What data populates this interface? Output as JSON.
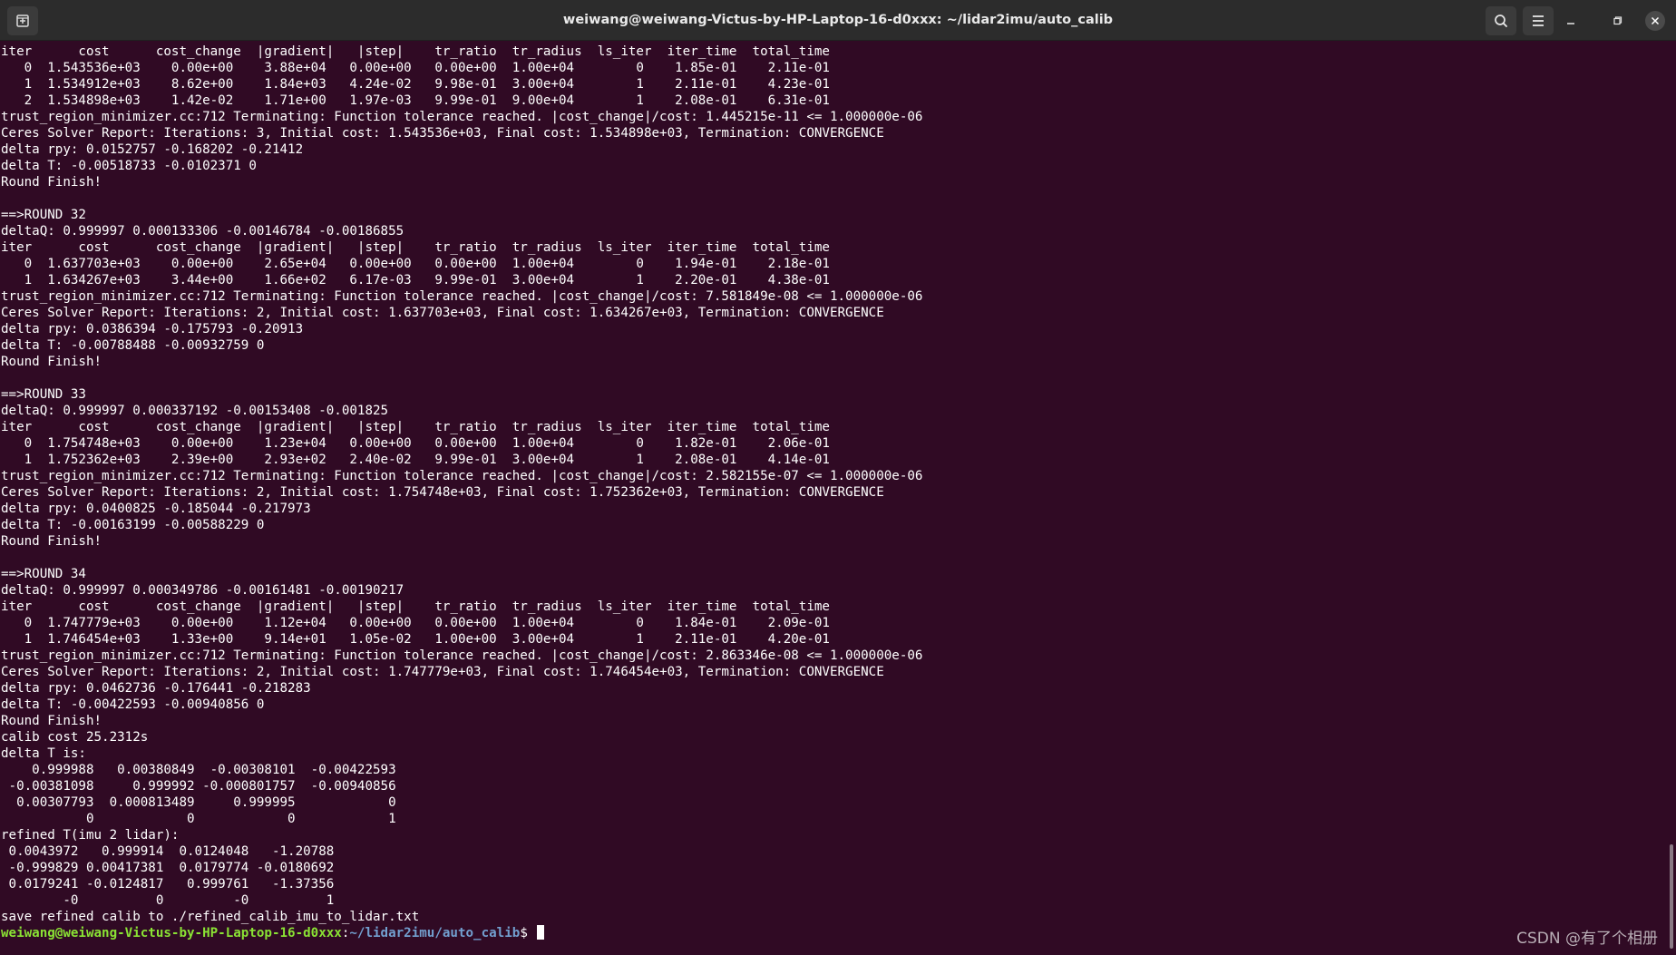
{
  "window": {
    "title": "weiwang@weiwang-Victus-by-HP-Laptop-16-d0xxx: ~/lidar2imu/auto_calib",
    "icons": {
      "new_tab": "new-tab-icon",
      "search": "search-icon",
      "menu": "hamburger-menu-icon",
      "minimize": "minimize-icon",
      "maximize": "maximize-icon",
      "close": "close-icon"
    }
  },
  "terminal": {
    "lines": [
      "iter      cost      cost_change  |gradient|   |step|    tr_ratio  tr_radius  ls_iter  iter_time  total_time",
      "   0  1.543536e+03    0.00e+00    3.88e+04   0.00e+00   0.00e+00  1.00e+04        0    1.85e-01    2.11e-01",
      "   1  1.534912e+03    8.62e+00    1.84e+03   4.24e-02   9.98e-01  3.00e+04        1    2.11e-01    4.23e-01",
      "   2  1.534898e+03    1.42e-02    1.71e+00   1.97e-03   9.99e-01  9.00e+04        1    2.08e-01    6.31e-01",
      "trust_region_minimizer.cc:712 Terminating: Function tolerance reached. |cost_change|/cost: 1.445215e-11 <= 1.000000e-06",
      "Ceres Solver Report: Iterations: 3, Initial cost: 1.543536e+03, Final cost: 1.534898e+03, Termination: CONVERGENCE",
      "delta rpy: 0.0152757 -0.168202 -0.21412",
      "delta T: -0.00518733 -0.0102371 0",
      "Round Finish!",
      "",
      "==>ROUND 32",
      "deltaQ: 0.999997 0.000133306 -0.00146784 -0.00186855",
      "iter      cost      cost_change  |gradient|   |step|    tr_ratio  tr_radius  ls_iter  iter_time  total_time",
      "   0  1.637703e+03    0.00e+00    2.65e+04   0.00e+00   0.00e+00  1.00e+04        0    1.94e-01    2.18e-01",
      "   1  1.634267e+03    3.44e+00    1.66e+02   6.17e-03   9.99e-01  3.00e+04        1    2.20e-01    4.38e-01",
      "trust_region_minimizer.cc:712 Terminating: Function tolerance reached. |cost_change|/cost: 7.581849e-08 <= 1.000000e-06",
      "Ceres Solver Report: Iterations: 2, Initial cost: 1.637703e+03, Final cost: 1.634267e+03, Termination: CONVERGENCE",
      "delta rpy: 0.0386394 -0.175793 -0.20913",
      "delta T: -0.00788488 -0.00932759 0",
      "Round Finish!",
      "",
      "==>ROUND 33",
      "deltaQ: 0.999997 0.000337192 -0.00153408 -0.001825",
      "iter      cost      cost_change  |gradient|   |step|    tr_ratio  tr_radius  ls_iter  iter_time  total_time",
      "   0  1.754748e+03    0.00e+00    1.23e+04   0.00e+00   0.00e+00  1.00e+04        0    1.82e-01    2.06e-01",
      "   1  1.752362e+03    2.39e+00    2.93e+02   2.40e-02   9.99e-01  3.00e+04        1    2.08e-01    4.14e-01",
      "trust_region_minimizer.cc:712 Terminating: Function tolerance reached. |cost_change|/cost: 2.582155e-07 <= 1.000000e-06",
      "Ceres Solver Report: Iterations: 2, Initial cost: 1.754748e+03, Final cost: 1.752362e+03, Termination: CONVERGENCE",
      "delta rpy: 0.0400825 -0.185044 -0.217973",
      "delta T: -0.00163199 -0.00588229 0",
      "Round Finish!",
      "",
      "==>ROUND 34",
      "deltaQ: 0.999997 0.000349786 -0.00161481 -0.00190217",
      "iter      cost      cost_change  |gradient|   |step|    tr_ratio  tr_radius  ls_iter  iter_time  total_time",
      "   0  1.747779e+03    0.00e+00    1.12e+04   0.00e+00   0.00e+00  1.00e+04        0    1.84e-01    2.09e-01",
      "   1  1.746454e+03    1.33e+00    9.14e+01   1.05e-02   1.00e+00  3.00e+04        1    2.11e-01    4.20e-01",
      "trust_region_minimizer.cc:712 Terminating: Function tolerance reached. |cost_change|/cost: 2.863346e-08 <= 1.000000e-06",
      "Ceres Solver Report: Iterations: 2, Initial cost: 1.747779e+03, Final cost: 1.746454e+03, Termination: CONVERGENCE",
      "delta rpy: 0.0462736 -0.176441 -0.218283",
      "delta T: -0.00422593 -0.00940856 0",
      "Round Finish!",
      "calib cost 25.2312s",
      "delta T is:",
      "    0.999988   0.00380849  -0.00308101  -0.00422593",
      " -0.00381098     0.999992 -0.000801757  -0.00940856",
      "  0.00307793  0.000813489     0.999995            0",
      "           0            0            0            1",
      "refined T(imu 2 lidar):",
      " 0.0043972   0.999914  0.0124048   -1.20788",
      " -0.999829 0.00417381  0.0179774 -0.0180692",
      " 0.0179241 -0.0124817   0.999761   -1.37356",
      "        -0          0         -0          1",
      "save refined calib to ./refined_calib_imu_to_lidar.txt"
    ],
    "prompt": {
      "user_host": "weiwang@weiwang-Victus-by-HP-Laptop-16-d0xxx",
      "colon": ":",
      "path": "~/lidar2imu/auto_calib",
      "dollar": "$ "
    }
  },
  "watermark": "CSDN @有了个相册",
  "colors": {
    "background": "#300a24",
    "titlebar": "#2c2c2c",
    "prompt_user": "#8ae234",
    "prompt_path": "#729fcf",
    "text": "#ffffff"
  }
}
